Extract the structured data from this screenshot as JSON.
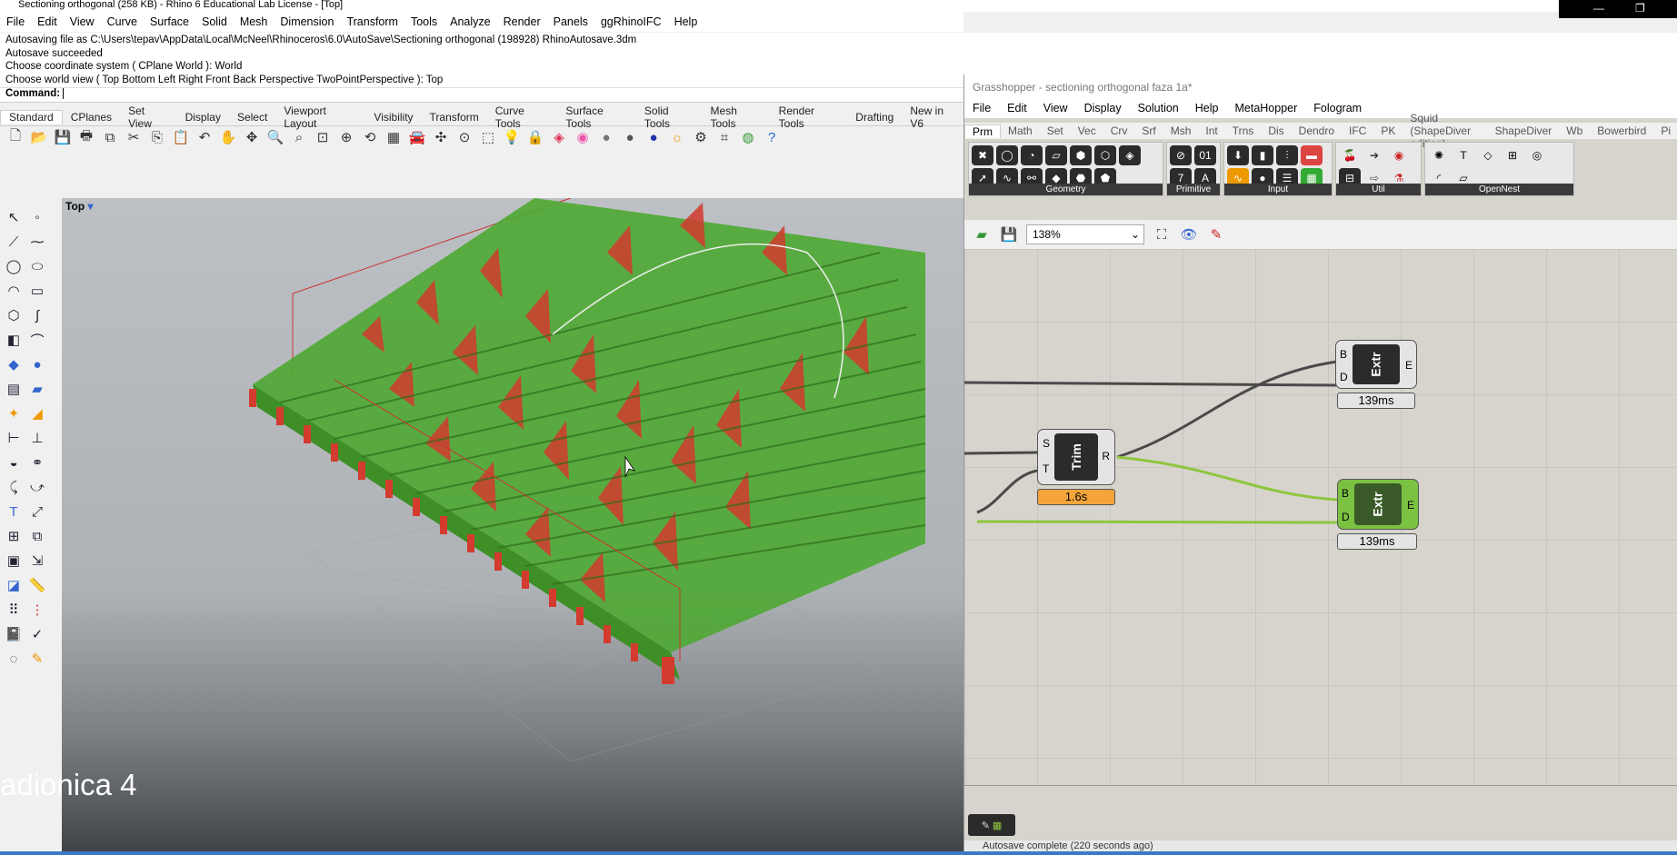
{
  "window": {
    "title": "Sectioning orthogonal (258 KB) - Rhino 6 Educational Lab License - [Top]",
    "minimize": "—",
    "restore": "❐"
  },
  "rhino_menu": [
    "File",
    "Edit",
    "View",
    "Curve",
    "Surface",
    "Solid",
    "Mesh",
    "Dimension",
    "Transform",
    "Tools",
    "Analyze",
    "Render",
    "Panels",
    "ggRhinoIFC",
    "Help"
  ],
  "command_history": [
    "Autosaving file as C:\\Users\\tepav\\AppData\\Local\\McNeel\\Rhinoceros\\6.0\\AutoSave\\Sectioning orthogonal (198928) RhinoAutosave.3dm",
    "Autosave succeeded",
    "Choose coordinate system ( CPlane  World ): World",
    "Choose world view ( Top  Bottom  Left  Right  Front  Back  Perspective  TwoPointPerspective ): Top"
  ],
  "command_prompt": "Command:",
  "rhino_tabs": [
    "Standard",
    "CPlanes",
    "Set View",
    "Display",
    "Select",
    "Viewport Layout",
    "Visibility",
    "Transform",
    "Curve Tools",
    "Surface Tools",
    "Solid Tools",
    "Mesh Tools",
    "Render Tools",
    "Drafting",
    "New in V6"
  ],
  "viewport": {
    "label": "Top",
    "dropdown": "▾"
  },
  "watermark": "adionica 4",
  "grasshopper": {
    "title": "Grasshopper - sectioning orthogonal faza 1a*",
    "menu": [
      "File",
      "Edit",
      "View",
      "Display",
      "Solution",
      "Help",
      "MetaHopper",
      "Fologram"
    ],
    "tabs": [
      "Prm",
      "Math",
      "Set",
      "Vec",
      "Crv",
      "Srf",
      "Msh",
      "Int",
      "Trns",
      "Dis",
      "Dendro",
      "IFC",
      "PK",
      "Squid (ShapeDiver edition)",
      "ShapeDiver",
      "Wb",
      "Bowerbird",
      "Pi"
    ],
    "ribbon_groups": [
      {
        "caption": "Geometry",
        "count": 14
      },
      {
        "caption": "Primitive",
        "count": 4
      },
      {
        "caption": "Input",
        "count": 6
      },
      {
        "caption": "Util",
        "count": 4
      },
      {
        "caption": "OpenNest",
        "count": 6
      }
    ],
    "zoom": "138%",
    "components": {
      "extr1": {
        "name": "Extr",
        "in1": "B",
        "in2": "D",
        "out": "E",
        "time": "139ms"
      },
      "trim": {
        "name": "Trim",
        "in1": "S",
        "in2": "T",
        "out": "R",
        "time": "1.6s"
      },
      "extr2": {
        "name": "Extr",
        "in1": "B",
        "in2": "D",
        "out": "E",
        "time": "139ms"
      }
    },
    "status": "Autosave complete (220 seconds ago)",
    "colors": {
      "wire_dark": "#4a4a4a",
      "wire_selected": "#8ec63f",
      "component_selected": "#7cc242",
      "warning": "#f3a53a"
    }
  }
}
